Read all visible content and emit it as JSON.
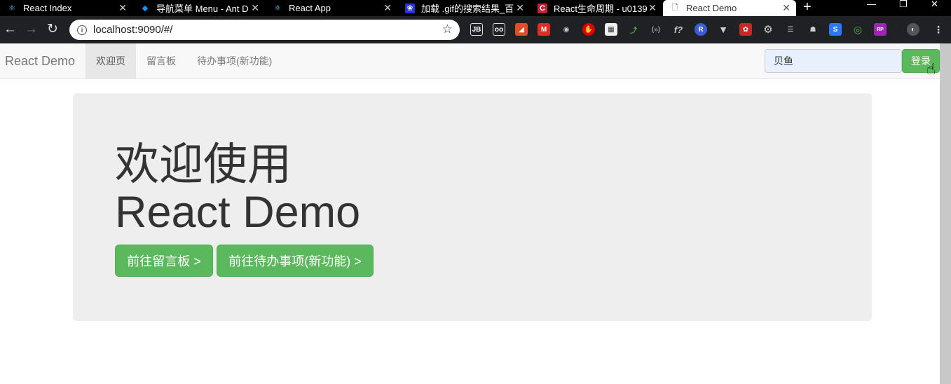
{
  "browser": {
    "tabs": [
      {
        "title": "React Index",
        "icon": "react-icon",
        "active": false
      },
      {
        "title": "导航菜单 Menu - Ant D",
        "icon": "ant-design-icon",
        "active": false
      },
      {
        "title": "React App",
        "icon": "react-icon",
        "active": false
      },
      {
        "title": "加载 .gif的搜索结果_百",
        "icon": "baidu-icon",
        "active": false
      },
      {
        "title": "React生命周期 - u0139",
        "icon": "csdn-icon",
        "active": false
      },
      {
        "title": "React Demo",
        "icon": "page-icon",
        "active": true
      }
    ],
    "url": "localhost:9090/#/"
  },
  "navbar": {
    "brand": "React Demo",
    "links": [
      "欢迎页",
      "留言板",
      "待办事项(新功能)"
    ],
    "active_index": 0,
    "search_value": "贝鱼",
    "login_label": "登录"
  },
  "jumbotron": {
    "title_line1": "欢迎使用",
    "title_line2": "React Demo",
    "btn_board": "前往留言板 >",
    "btn_todo": "前往待办事项(新功能) >"
  },
  "colors": {
    "success": "#5cb85c",
    "jumbotron_bg": "#eeeeee",
    "navbar_bg": "#f8f8f8"
  }
}
